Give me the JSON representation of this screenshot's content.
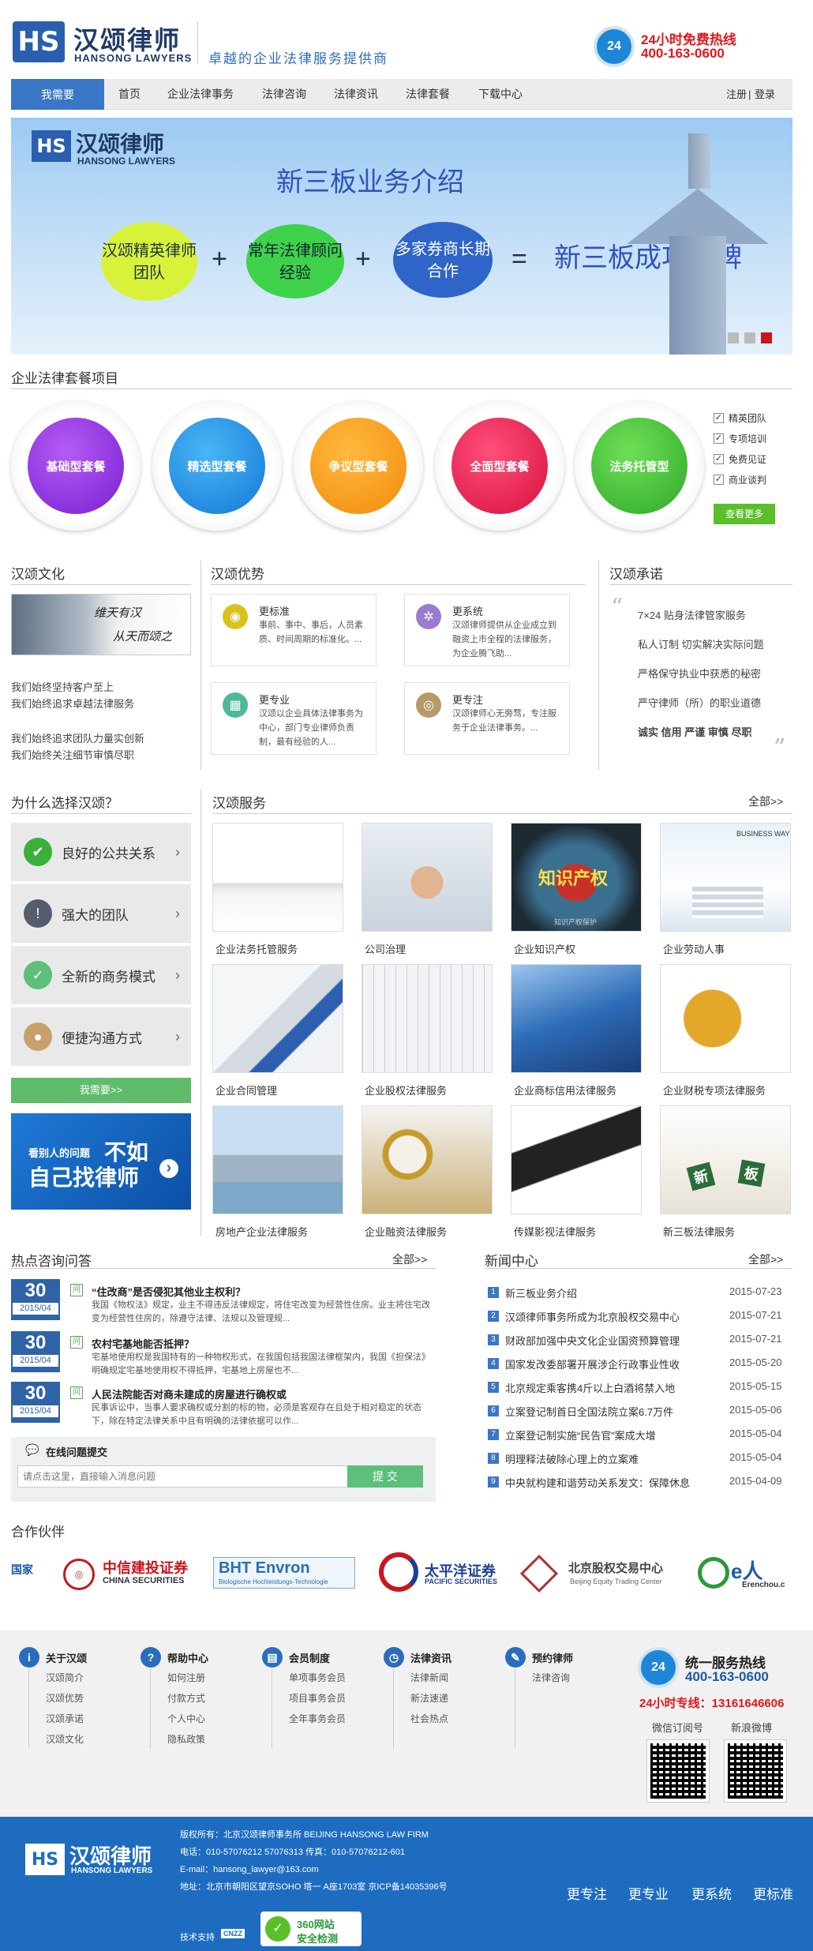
{
  "header": {
    "logo_mark": "HS",
    "logo_cn": "汉颂律师",
    "logo_en": "HANSONG LAWYERS",
    "slogan": "卓越的企业法律服务提供商",
    "hotline_icon": "24",
    "hotline_title": "24小时免费热线",
    "hotline_number": "400-163-0600"
  },
  "nav": {
    "main": "我需要",
    "items": [
      "首页",
      "企业法律事务",
      "法律咨询",
      "法律资讯",
      "法律套餐",
      "下载中心"
    ],
    "register": "注册",
    "sep": "|",
    "login": "登录"
  },
  "banner": {
    "logo_cn": "汉颂律师",
    "logo_en": "HANSONG LAWYERS",
    "headline": "新三板业务介绍",
    "bubble1": "汉颂精英律师团队",
    "bubble2": "常年法律顾问经验",
    "bubble3": "多家券商长期合作",
    "plus": "+",
    "equals": "=",
    "result": "新三板成功挂牌"
  },
  "packages": {
    "title": "企业法律套餐项目",
    "items": [
      {
        "label": "基础型套餐",
        "color": "#8a2be2"
      },
      {
        "label": "精选型套餐",
        "color": "#1c8fe0"
      },
      {
        "label": "争议型套餐",
        "color": "#f7941d"
      },
      {
        "label": "全面型套餐",
        "color": "#e8194f"
      },
      {
        "label": "法务托管型",
        "color": "#3db83a"
      }
    ],
    "checks": [
      "精英团队",
      "专项培训",
      "免费见证",
      "商业谈判"
    ],
    "more_button": "查看更多"
  },
  "culture": {
    "title": "汉颂文化",
    "image_text1": "维天有汉",
    "image_text2": "从天而颂之",
    "lines": [
      "我们始终坚持客户至上",
      "我们始终追求卓越法律服务",
      "我们始终追求团队力量实创新",
      "我们始终关注细节审慎尽职"
    ]
  },
  "advantages": {
    "title": "汉颂优势",
    "items": [
      {
        "title": "更标准",
        "text": "事前、事中、事后，人员素质、时间周期的标准化。...",
        "color": "#d9c21a"
      },
      {
        "title": "更系统",
        "text": "汉颂律师提供从企业成立到融资上市全程的法律服务，为企业腾飞助...",
        "color": "#9b7bd0"
      },
      {
        "title": "更专业",
        "text": "汉颂以企业具体法律事务为中心，部门专业律师负责制，最有经验的人...",
        "color": "#4db89a"
      },
      {
        "title": "更专注",
        "text": "汉颂律师心无旁骛，专注服务于企业法律事务。...",
        "color": "#b79a6a"
      }
    ]
  },
  "promise": {
    "title": "汉颂承诺",
    "lines": [
      "7×24 贴身法律管家服务",
      "私人订制 切实解决实际问题",
      "严格保守执业中获悉的秘密",
      "严守律师（所）的职业道德"
    ],
    "keywords": "诚实 信用 严谨 审慎 尽职"
  },
  "why": {
    "title": "为什么选择汉颂？",
    "items": [
      {
        "label": "良好的公共关系",
        "color": "#3ab03a",
        "icon": "✔"
      },
      {
        "label": "强大的团队",
        "color": "#555c6b",
        "icon": "!"
      },
      {
        "label": "全新的商务模式",
        "color": "#5cbf7a",
        "icon": "✓"
      },
      {
        "label": "便捷沟通方式",
        "color": "#c9a06a",
        "icon": "●"
      }
    ],
    "need_button": "我需要>>",
    "ad_line1": "看别人的问题",
    "ad_line2": "不如",
    "ad_line3": "自己找律师",
    "ad_arrow": "›"
  },
  "services": {
    "title": "汉颂服务",
    "more": "全部>>",
    "items": [
      "企业法务托管服务",
      "公司治理",
      "企业知识产权",
      "企业劳动人事",
      "企业合同管理",
      "企业股权法律服务",
      "企业商标信用法律服务",
      "企业财税专项法律服务",
      "房地产企业法律服务",
      "企业融资法律服务",
      "传媒影视法律服务",
      "新三板法律服务"
    ],
    "image_texts": [
      "知识产权",
      "知识产权保护",
      "BUSINESS WAY",
      "新",
      "板"
    ]
  },
  "qa": {
    "title": "热点咨询问答",
    "more": "全部>>",
    "q_tag": "问",
    "items": [
      {
        "day": "30",
        "ym": "2015/04",
        "title": "“住改商”是否侵犯其他业主权利？",
        "text": "我国《物权法》规定，业主不得违反法律规定，将住宅改变为经营性住房。业主将住宅改变为经营性住房的，除遵守法律、法规以及管理规..."
      },
      {
        "day": "30",
        "ym": "2015/04",
        "title": "农村宅基地能否抵押？",
        "text": "宅基地使用权是我国特有的一种物权形式，在我国包括我国法律框架内，我国《担保法》明确规定宅基地使用权不得抵押，宅基地上房屋也不..."
      },
      {
        "day": "30",
        "ym": "2015/04",
        "title": "人民法院能否对商未建成的房屋进行确权或",
        "text": "民事诉讼中，当事人要求确权或分割的标的物，必须是客观存在且处于相对稳定的状态下，除在特定法律关系中且有明确的法律依据可以作..."
      }
    ],
    "submit_title": "在线问题提交",
    "input_placeholder": "请点击这里，直接输入消息问题",
    "submit_button": "提 交"
  },
  "news": {
    "title": "新闻中心",
    "more": "全部>>",
    "items": [
      {
        "n": "1",
        "title": "新三板业务介绍",
        "date": "2015-07-23"
      },
      {
        "n": "2",
        "title": "汉颂律师事务所成为北京股权交易中心",
        "date": "2015-07-21"
      },
      {
        "n": "3",
        "title": "财政部加强中央文化企业国资预算管理",
        "date": "2015-07-21"
      },
      {
        "n": "4",
        "title": "国家发改委部署开展涉企行政事业性收",
        "date": "2015-05-20"
      },
      {
        "n": "5",
        "title": "北京规定乘客携4斤以上白酒将禁入地",
        "date": "2015-05-15"
      },
      {
        "n": "6",
        "title": "立案登记制首日全国法院立案6.7万件",
        "date": "2015-05-06"
      },
      {
        "n": "7",
        "title": "立案登记制实施“民告官”案成大增",
        "date": "2015-05-04"
      },
      {
        "n": "8",
        "title": "明理释法破除心理上的立案难",
        "date": "2015-05-04"
      },
      {
        "n": "9",
        "title": "中央就构建和谐劳动关系发文：保障休息",
        "date": "2015-04-09"
      }
    ]
  },
  "partners": {
    "title": "合作伙伴",
    "items": [
      {
        "name": "国家",
        "sub": "",
        "color": "#1d5aa8"
      },
      {
        "name": "中信建投证券",
        "sub": "CHINA SECURITIES",
        "color": "#c8161d"
      },
      {
        "name": "BHT Envron",
        "sub": "Biologische Hochleistungs-Technologie",
        "color": "#2a6db5"
      },
      {
        "name": "太平洋证券",
        "sub": "PACIFIC SECURITIES",
        "color": "#1d3f8f"
      },
      {
        "name": "北京股权交易中心",
        "sub": "Beijing Equity Trading Center",
        "color": "#a33"
      },
      {
        "name": "e人",
        "sub": "Erenchou.c",
        "color": "#2a9a3a"
      }
    ]
  },
  "footer": {
    "cols": [
      {
        "icon": "i",
        "title": "关于汉颂",
        "links": [
          "汉颂简介",
          "汉颂优势",
          "汉颂承诺",
          "汉颂文化"
        ]
      },
      {
        "icon": "?",
        "title": "帮助中心",
        "links": [
          "如何注册",
          "付款方式",
          "个人中心",
          "隐私政策"
        ]
      },
      {
        "icon": "▤",
        "title": "会员制度",
        "links": [
          "单项事务会员",
          "项目事务会员",
          "全年事务会员"
        ]
      },
      {
        "icon": "◷",
        "title": "法律资讯",
        "links": [
          "法律新闻",
          "新法速递",
          "社会热点"
        ]
      },
      {
        "icon": "✎",
        "title": "预约律师",
        "links": [
          "法律咨询"
        ]
      }
    ],
    "hotline_icon": "24",
    "hotline_title": "统一服务热线",
    "hotline_number": "400-163-0600",
    "hotline_24": "24小时专线：13161646606",
    "wechat": "微信订阅号",
    "weibo": "新浪微博"
  },
  "bottom": {
    "logo_cn": "汉颂律师",
    "logo_en": "HANSONG LAWYERS",
    "copyright": "版权所有：北京汉颂律师事务所   BEIJING HANSONG LAW FIRM",
    "phone": "电话：010-57076212 57076313   传真：010-57076212-601",
    "email": "E-mail：hansong_lawyer@163.com",
    "address": "地址：北京市朝阳区望京SOHO 塔一 A座1703室    京ICP备14035396号",
    "support": "技术支持",
    "cnzz": "CNZZ",
    "badge_line1": "360网站",
    "badge_line2": "安全检测",
    "slogans": [
      "更专注",
      "更专业",
      "更系统",
      "更标准"
    ]
  }
}
